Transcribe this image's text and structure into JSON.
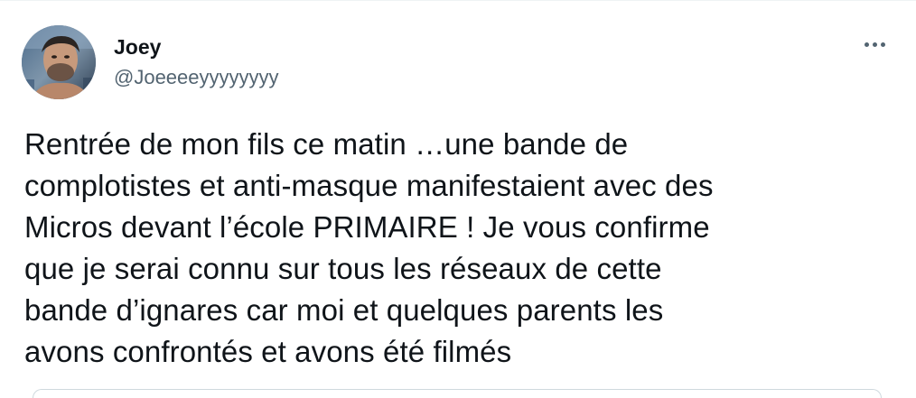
{
  "user": {
    "display_name": "Joey",
    "handle": "@Joeeeeyyyyyyyy",
    "avatar_icon": "profile-photo"
  },
  "actions": {
    "more_icon": "more-dots-icon"
  },
  "tweet": {
    "text": "Rentrée de mon fils ce matin …une bande de\ncomplotistes et anti-masque manifestaient avec des\nMicros devant l’école PRIMAIRE ! Je vous confirme\nque je serai connu sur tous les réseaux de cette\nbande d’ignares car moi et quelques parents les\navons confrontés et avons été filmés"
  },
  "colors": {
    "text_primary": "#0f1419",
    "text_secondary": "#536471",
    "divider": "#eff3f4",
    "card_border": "#cfd9de"
  }
}
